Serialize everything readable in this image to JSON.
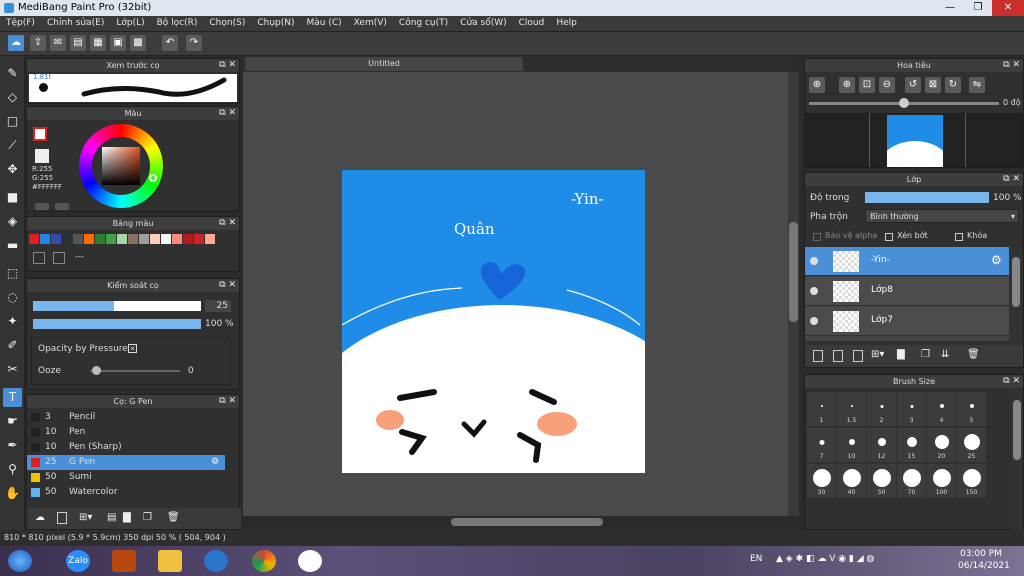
{
  "window": {
    "title": "MediBang Paint Pro (32bit)"
  },
  "menu": [
    "Tệp(F)",
    "Chỉnh sửa(E)",
    "Lớp(L)",
    "Bộ lọc(R)",
    "Chọn(S)",
    "Chụp(N)",
    "Màu (C)",
    "Xem(V)",
    "Công cụ(T)",
    "Cửa sổ(W)",
    "Cloud",
    "Help"
  ],
  "brush_preview": {
    "title": "Xem trước cọ",
    "size": "1.81t"
  },
  "color": {
    "title": "Màu",
    "r": "R:255",
    "g": "G:255",
    "hex": "#FFFFFF",
    "fg": "#ffffff",
    "bg": "#ffffff"
  },
  "palette": {
    "title": "Bảng màu",
    "colors": [
      "#e02020",
      "#1e88e5",
      "#3949ab",
      "#263238",
      "#555555",
      "#ff6d00",
      "#2e7d32",
      "#43a047",
      "#a5d6a7",
      "#8d6e63",
      "#9e9e9e",
      "#ffccbc",
      "#f5f5f5",
      "#ff8a80",
      "#b71c1c",
      "#c62828",
      "#ffab91"
    ],
    "extra": "---"
  },
  "brush_control": {
    "title": "Kiểm soát cọ",
    "size_value": "25",
    "opacity_value": "100 %",
    "size_fraction": 0.48,
    "opacity_fraction": 1.0,
    "opacity_pressure_label": "Opacity by Pressure",
    "ooze_label": "Ooze",
    "ooze_value": "0"
  },
  "brush_list": {
    "title": "Cọ: G Pen",
    "items": [
      {
        "size": "3",
        "name": "Pencil",
        "color": "#222222"
      },
      {
        "size": "10",
        "name": "Pen",
        "color": "#222222"
      },
      {
        "size": "10",
        "name": "Pen (Sharp)",
        "color": "#222222"
      },
      {
        "size": "25",
        "name": "G Pen",
        "color": "#e02020"
      },
      {
        "size": "50",
        "name": "Sumi",
        "color": "#f2c200"
      },
      {
        "size": "50",
        "name": "Watercolor",
        "color": "#5fb3f0"
      }
    ]
  },
  "document": {
    "tab": "Untitled",
    "sign": "-Yin-",
    "name": "Quân"
  },
  "navigator": {
    "title": "Hoa tiêu",
    "angle": "0 độ"
  },
  "layers": {
    "title": "Lớp",
    "opacity_label": "Độ trong",
    "opacity_value": "100 %",
    "blend_label": "Pha trộn",
    "blend_value": "Bình thường",
    "protect_alpha": "Bảo vệ alpha",
    "clip": "Xén bớt",
    "lock": "Khóa",
    "items": [
      "-Yin-",
      "Lớp8",
      "Lớp7"
    ]
  },
  "brush_size": {
    "title": "Brush Size",
    "rows": [
      [
        "1",
        "1.5",
        "2",
        "3",
        "4",
        "5"
      ],
      [
        "7",
        "10",
        "12",
        "15",
        "20",
        "25"
      ],
      [
        "30",
        "40",
        "50",
        "70",
        "100",
        "150"
      ]
    ]
  },
  "status": {
    "text": "810 * 810 pixel  (5.9 * 5.9cm)  350 dpi  50 %  ( 504, 904 )"
  },
  "taskbar": {
    "lang": "EN",
    "time": "03:00 PM",
    "date": "06/14/2021",
    "zalo": "Zalo"
  }
}
